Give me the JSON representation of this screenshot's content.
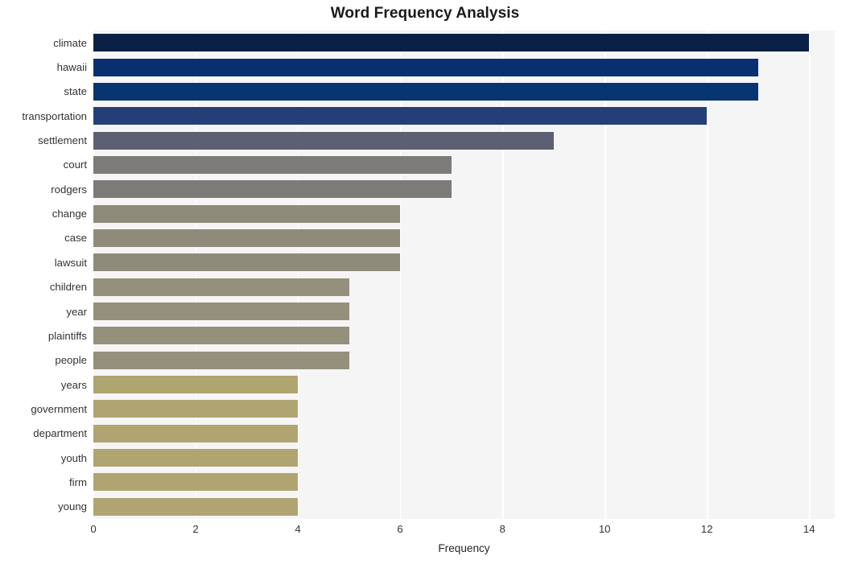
{
  "chart_data": {
    "type": "bar",
    "orientation": "horizontal",
    "title": "Word Frequency Analysis",
    "xlabel": "Frequency",
    "ylabel": "",
    "categories": [
      "climate",
      "hawaii",
      "state",
      "transportation",
      "settlement",
      "court",
      "rodgers",
      "change",
      "case",
      "lawsuit",
      "children",
      "year",
      "plaintiffs",
      "people",
      "years",
      "government",
      "department",
      "youth",
      "firm",
      "young"
    ],
    "values": [
      14,
      13,
      13,
      12,
      9,
      7,
      7,
      6,
      6,
      6,
      5,
      5,
      5,
      5,
      4,
      4,
      4,
      4,
      4,
      4
    ],
    "bar_colors": [
      "#0b2045",
      "#083070",
      "#083572",
      "#253f76",
      "#5d6072",
      "#7c7b78",
      "#7c7b78",
      "#8e8b7a",
      "#8e8b7a",
      "#8e8b7a",
      "#95907c",
      "#95907c",
      "#95907c",
      "#95907c",
      "#b0a471",
      "#b0a471",
      "#b0a471",
      "#b0a471",
      "#b0a471",
      "#b0a471"
    ],
    "xlim": [
      0,
      14.5
    ],
    "xticks": [
      0,
      2,
      4,
      6,
      8,
      10,
      12,
      14
    ],
    "xtick_labels": [
      "0",
      "2",
      "4",
      "6",
      "8",
      "10",
      "12",
      "14"
    ],
    "grid": true,
    "grid_axis": "x",
    "legend": "none",
    "plot_background": "#f5f5f6",
    "figure_background": "#ffffff",
    "gridline_color": "#ffffff",
    "tick_label_color": "#333333",
    "title_color": "#1a1a1a"
  }
}
